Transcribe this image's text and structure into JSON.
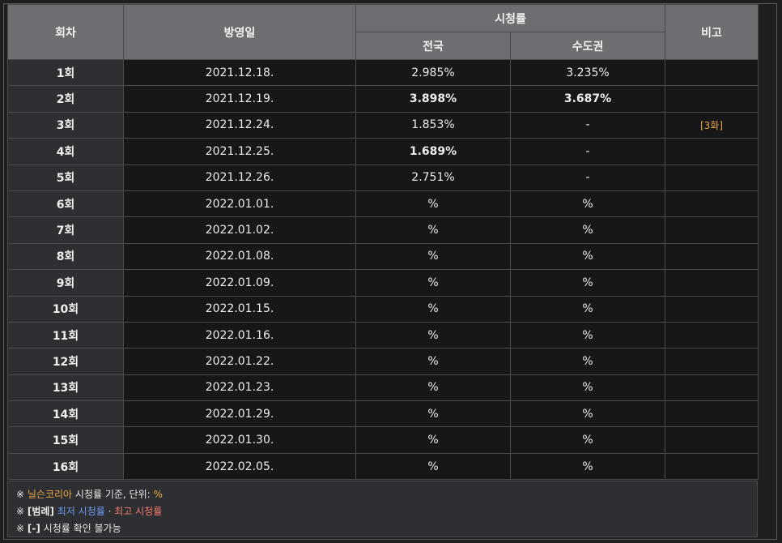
{
  "headers": {
    "episode": "회차",
    "air_date": "방영일",
    "ratings": "시청률",
    "nationwide": "전국",
    "capital": "수도권",
    "remark": "비고"
  },
  "rows": [
    {
      "ep": "1회",
      "date": "2021.12.18.",
      "nat": "2.985%",
      "cap": "3.235%",
      "note": ""
    },
    {
      "ep": "2회",
      "date": "2021.12.19.",
      "nat": "3.898%",
      "cap": "3.687%",
      "note": ""
    },
    {
      "ep": "3회",
      "date": "2021.12.24.",
      "nat": "1.853%",
      "cap": "-",
      "note": "[3화]"
    },
    {
      "ep": "4회",
      "date": "2021.12.25.",
      "nat": "1.689%",
      "cap": "-",
      "note": ""
    },
    {
      "ep": "5회",
      "date": "2021.12.26.",
      "nat": "2.751%",
      "cap": "-",
      "note": ""
    },
    {
      "ep": "6회",
      "date": "2022.01.01.",
      "nat": "%",
      "cap": "%",
      "note": ""
    },
    {
      "ep": "7회",
      "date": "2022.01.02.",
      "nat": "%",
      "cap": "%",
      "note": ""
    },
    {
      "ep": "8회",
      "date": "2022.01.08.",
      "nat": "%",
      "cap": "%",
      "note": ""
    },
    {
      "ep": "9회",
      "date": "2022.01.09.",
      "nat": "%",
      "cap": "%",
      "note": ""
    },
    {
      "ep": "10회",
      "date": "2022.01.15.",
      "nat": "%",
      "cap": "%",
      "note": ""
    },
    {
      "ep": "11회",
      "date": "2022.01.16.",
      "nat": "%",
      "cap": "%",
      "note": ""
    },
    {
      "ep": "12회",
      "date": "2022.01.22.",
      "nat": "%",
      "cap": "%",
      "note": ""
    },
    {
      "ep": "13회",
      "date": "2022.01.23.",
      "nat": "%",
      "cap": "%",
      "note": ""
    },
    {
      "ep": "14회",
      "date": "2022.01.29.",
      "nat": "%",
      "cap": "%",
      "note": ""
    },
    {
      "ep": "15회",
      "date": "2022.01.30.",
      "nat": "%",
      "cap": "%",
      "note": ""
    },
    {
      "ep": "16회",
      "date": "2022.02.05.",
      "nat": "%",
      "cap": "%",
      "note": ""
    }
  ],
  "footer": {
    "mark": "※",
    "source_name": "닐슨코리아",
    "source_text": " 시청률 기준, 단위: ",
    "unit": "%",
    "legend_label": "[범례]",
    "lowest": "최저 시청률",
    "sep": " · ",
    "highest": "최고 시청률",
    "dash_label": "[-]",
    "dash_text": " 시청률 확인 불가능"
  },
  "colors": {
    "highest": "#f07a6a",
    "lowest": "#6f98f0",
    "accent": "#e8a640"
  }
}
